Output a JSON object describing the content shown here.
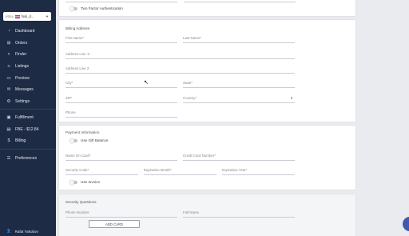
{
  "sidebar": {
    "store_tag": "eBay",
    "store_value": "fooli_d...",
    "items": [
      {
        "label": "Dashboard",
        "icon": "dashboard-icon"
      },
      {
        "label": "Orders",
        "icon": "cart-icon"
      },
      {
        "label": "Finder",
        "icon": "search-icon"
      },
      {
        "label": "Listings",
        "icon": "list-icon"
      },
      {
        "label": "Preview",
        "icon": "monitor-icon"
      },
      {
        "label": "Messages",
        "icon": "mail-icon"
      },
      {
        "label": "Settings",
        "icon": "gear-icon"
      },
      {
        "label": "Fulfillment",
        "icon": "box-icon"
      },
      {
        "label": "FBE - $12.84",
        "icon": "receipt-icon"
      },
      {
        "label": "Billing",
        "icon": "dollar-icon"
      },
      {
        "label": "Preferences",
        "icon": "sliders-icon"
      }
    ],
    "user_name": "Rafat Yakobov"
  },
  "two_factor": {
    "label": "Two Factor Authentication"
  },
  "billing": {
    "title": "Billing Address",
    "first_name": "First Name*",
    "last_name": "Last Name*",
    "address1": "Address Line 1*",
    "address2": "Address Line 2",
    "city": "City*",
    "state": "State*",
    "zip": "ZIP*",
    "country": "Country*",
    "phone": "Phone"
  },
  "payment": {
    "title": "Payment Information",
    "gift_balance": "Use Gift Balance",
    "name_on_card": "Name On Card*",
    "card_number": "Credit Card Number*",
    "security_code": "Security Code*",
    "exp_month": "Expiration Month*",
    "exp_year": "Expiration Year*",
    "invoice": "Use Invoice"
  },
  "security": {
    "title": "Security Questions",
    "phone_number": "Phone Number",
    "full_name": "Full Name",
    "add_card": "ADD CARD"
  },
  "colors": {
    "sidebar_bg": "#1e2b45",
    "accent": "#3f58b0"
  }
}
